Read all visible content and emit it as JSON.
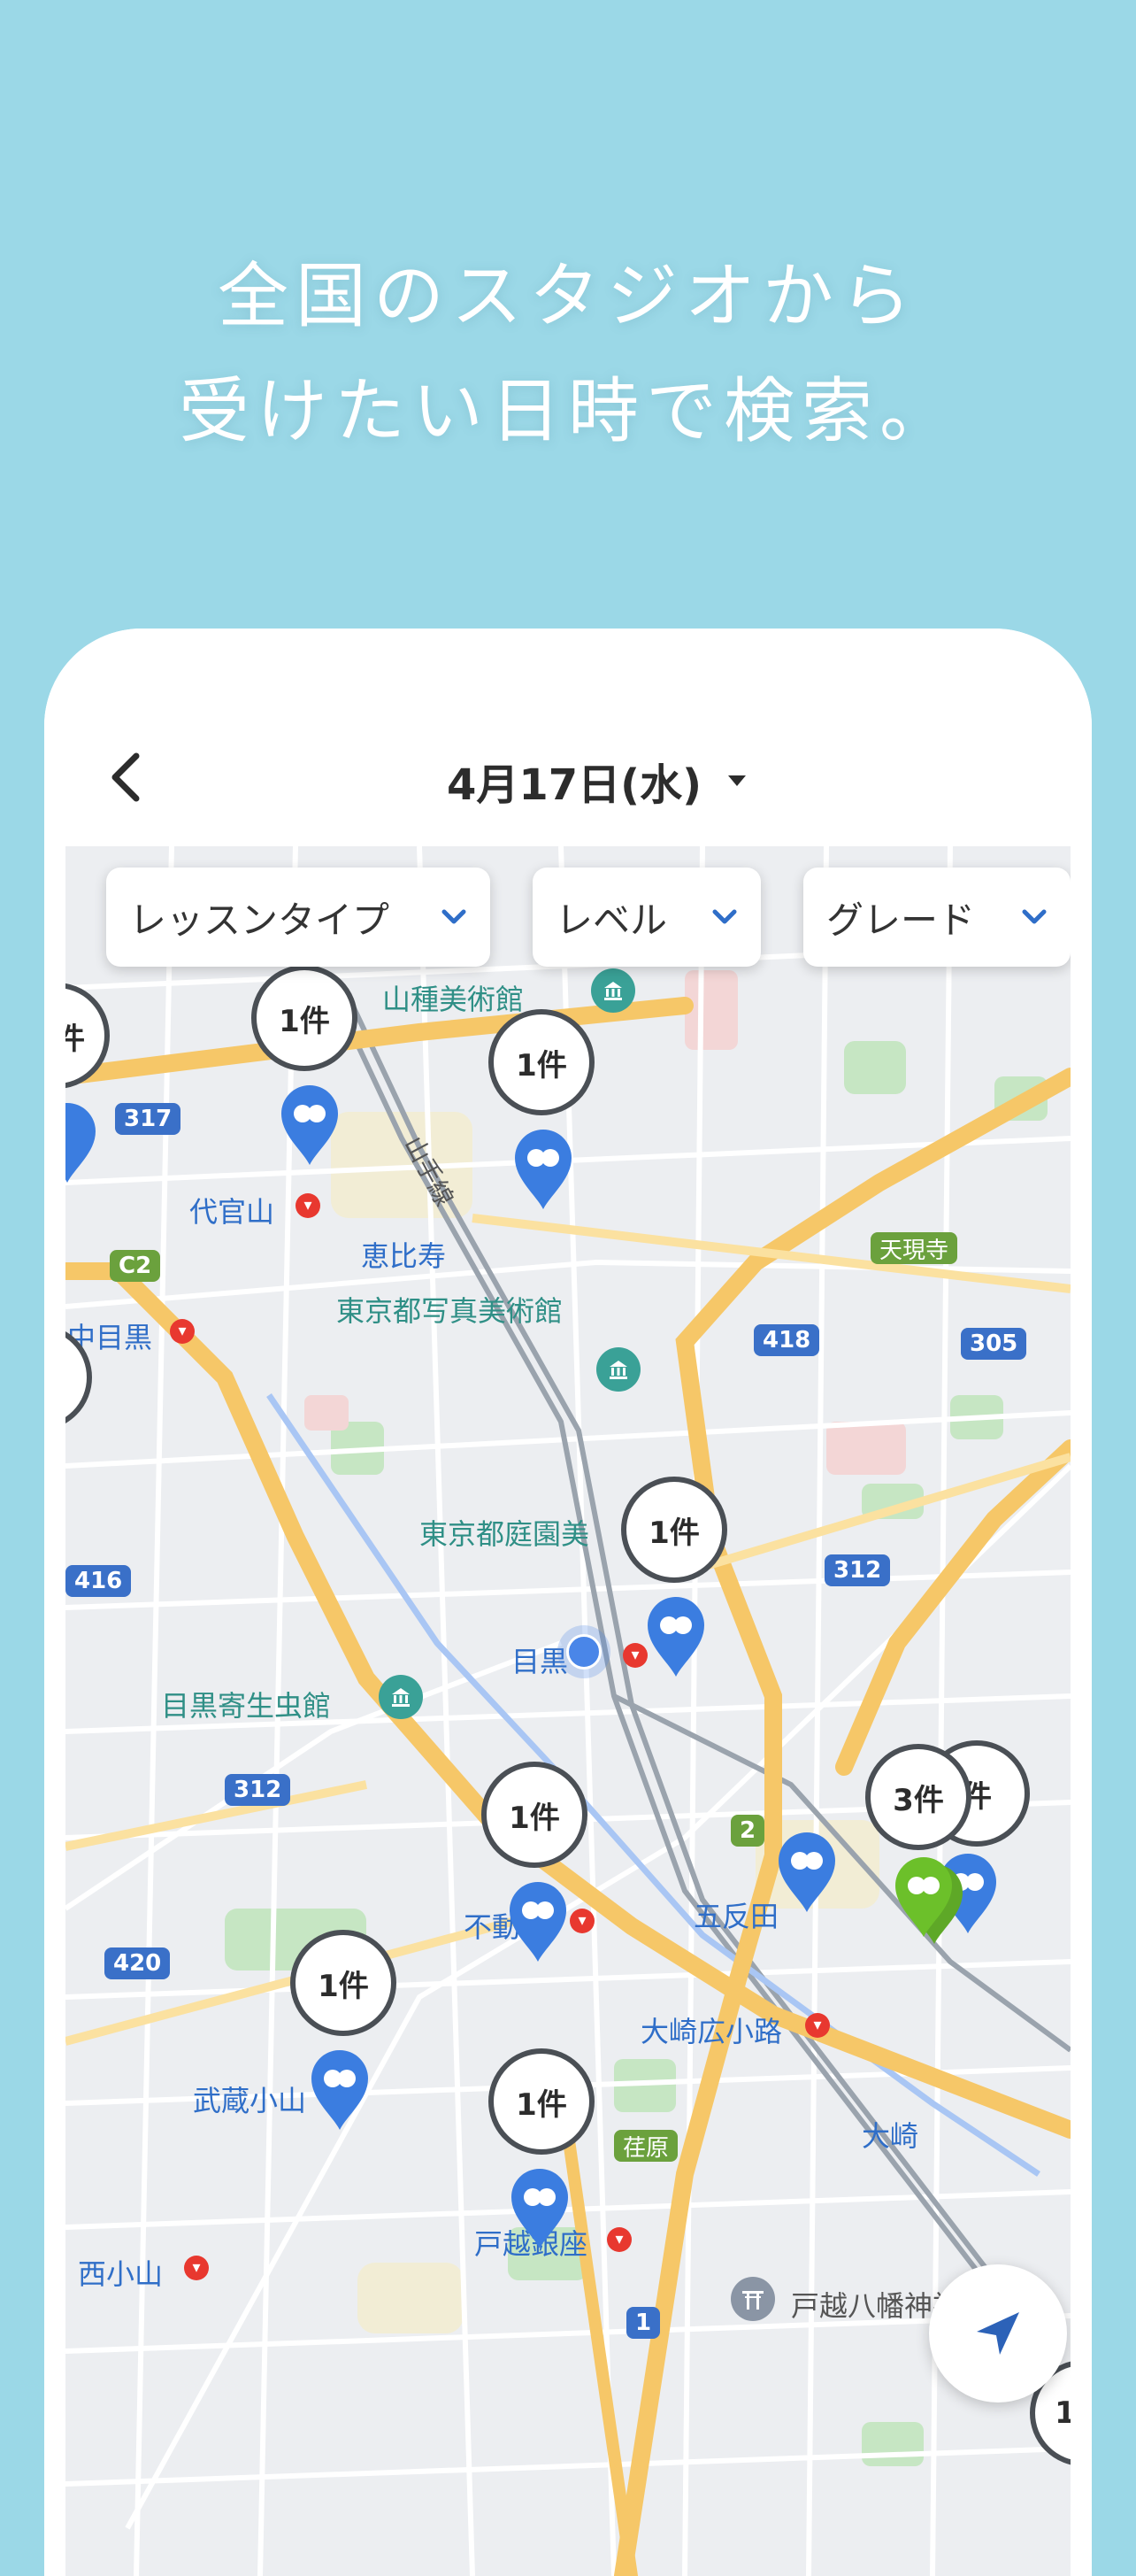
{
  "headline": {
    "line1": "全国のスタジオから",
    "line2": "受けたい日時で検索。"
  },
  "header": {
    "date": "4月17日(水)"
  },
  "filters": [
    {
      "label": "レッスンタイプ"
    },
    {
      "label": "レベル"
    },
    {
      "label": "グレード"
    }
  ],
  "map": {
    "places": [
      {
        "name": "山種美術館"
      },
      {
        "name": "山手線"
      },
      {
        "name": "代官山"
      },
      {
        "name": "恵比寿"
      },
      {
        "name": "東京都写真美術館"
      },
      {
        "name": "中目黒"
      },
      {
        "name": "天現寺"
      },
      {
        "name": "東京都庭園美"
      },
      {
        "name": "目黒"
      },
      {
        "name": "目黒寄生虫館"
      },
      {
        "name": "五反田"
      },
      {
        "name": "大崎広小路"
      },
      {
        "name": "武蔵小山"
      },
      {
        "name": "大崎"
      },
      {
        "name": "荏原"
      },
      {
        "name": "西小山"
      },
      {
        "name": "戸越銀座"
      },
      {
        "name": "戸越八幡神社"
      },
      {
        "name": "不動前"
      }
    ],
    "route_numbers": [
      "317",
      "C2",
      "418",
      "305",
      "416",
      "312",
      "312",
      "2",
      "420",
      "1"
    ],
    "pins": [
      {
        "count": "1件",
        "color": "#3b7de0"
      },
      {
        "count": "1件",
        "color": "#3b7de0"
      },
      {
        "count": "1件",
        "color": "#3b7de0"
      },
      {
        "count": "1件",
        "color": "#3b7de0"
      },
      {
        "count": "1件",
        "color": "#3b7de0"
      },
      {
        "count": "1件",
        "color": "#3b7de0"
      },
      {
        "count": "3件",
        "color": "#6cc02a"
      },
      {
        "count": "件",
        "color": "#3b7de0"
      },
      {
        "count": "件",
        "color": "#3b7de0"
      },
      {
        "count": "1",
        "color": "#3b7de0"
      }
    ]
  },
  "icons": {
    "back": "chevron-left-icon",
    "date_dropdown": "caret-down-icon",
    "filter_chevron": "chevron-down-icon",
    "locate": "navigation-arrow-icon",
    "current_location": "current-location-dot"
  },
  "colors": {
    "background": "#9bd8e7",
    "pin_blue": "#3b7de0",
    "pin_green": "#6cc02a",
    "filter_chevron": "#2f6ec8"
  }
}
